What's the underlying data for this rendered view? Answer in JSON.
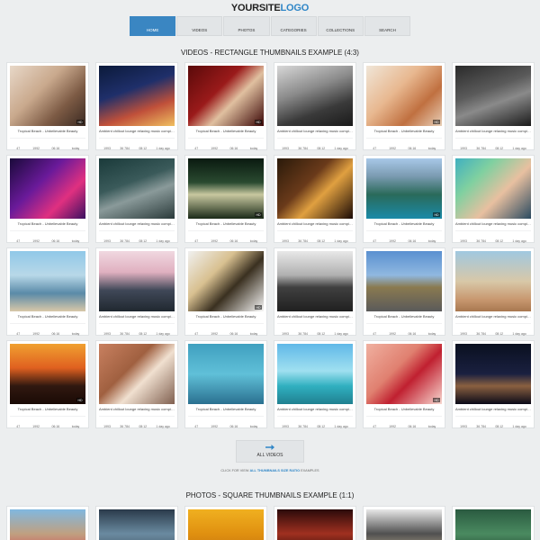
{
  "site": {
    "logo_part1": "YOURSITE",
    "logo_part2": "LOGO"
  },
  "nav": [
    {
      "label": "HOME",
      "icon": "home-icon",
      "active": true
    },
    {
      "label": "VIDEOS",
      "icon": "play-icon",
      "active": false
    },
    {
      "label": "PHOTOS",
      "icon": "photo-icon",
      "active": false
    },
    {
      "label": "CATEGORIES",
      "icon": "grid-icon",
      "active": false
    },
    {
      "label": "COLLECTIONS",
      "icon": "stack-icon",
      "active": false
    },
    {
      "label": "SEARCH",
      "icon": "search-icon",
      "active": false
    }
  ],
  "videos_section": {
    "title": "VIDEOS - RECTANGLE THUMBNAILS EXAMPLE (4:3)",
    "cards": [
      {
        "title": "Tropical Beach - Unbelievable Beauty",
        "badge": "HD",
        "stats": [
          "47",
          "1992",
          "06:16",
          "today"
        ],
        "bg": "linear-gradient(135deg,#e8d8c8 0%,#c9a98d 40%,#7c5a44 70%,#3a2a22 100%)"
      },
      {
        "title": "Ambient chillout lounge relaxing music compilation",
        "badge": "",
        "stats": [
          "1993",
          "36 784",
          "08:12",
          "1 day ago"
        ],
        "bg": "linear-gradient(160deg,#0b1a3a 0%,#1f2f6a 40%,#c0503a 70%,#f0c060 100%)"
      },
      {
        "title": "Tropical Beach - Unbelievable Beauty",
        "badge": "HD",
        "stats": [
          "47",
          "1992",
          "06:16",
          "today"
        ],
        "bg": "linear-gradient(135deg,#5a0a0a 0%,#9a1a1a 40%,#e0c0a0 60%,#3a0505 100%)"
      },
      {
        "title": "Ambient chillout lounge relaxing music compilation",
        "badge": "",
        "stats": [
          "1993",
          "36 784",
          "08:12",
          "1 day ago"
        ],
        "bg": "linear-gradient(160deg,#d8d8d8 0%,#8a8a8a 40%,#3a3a3a 70%,#1a1a1a 100%)"
      },
      {
        "title": "Tropical Beach - Unbelievable Beauty",
        "badge": "HD",
        "stats": [
          "47",
          "1992",
          "06:16",
          "today"
        ],
        "bg": "linear-gradient(135deg,#f0e6d8 0%,#e8b890 40%,#c07040 70%,#e8d0b8 100%)"
      },
      {
        "title": "Ambient chillout lounge relaxing music compilation",
        "badge": "",
        "stats": [
          "1993",
          "36 784",
          "08:12",
          "1 day ago"
        ],
        "bg": "linear-gradient(160deg,#2a2a2a 0%,#5a5a5a 40%,#8a8a8a 60%,#1a1a1a 100%)"
      },
      {
        "title": "Tropical Beach - Unbelievable Beauty",
        "badge": "",
        "stats": [
          "47",
          "1992",
          "06:16",
          "today"
        ],
        "bg": "linear-gradient(135deg,#1a0a3a 0%,#6a1a9a 40%,#e03080 70%,#3a1060 100%)"
      },
      {
        "title": "Ambient chillout lounge relaxing music compilation",
        "badge": "",
        "stats": [
          "1993",
          "36 784",
          "08:12",
          "1 day ago"
        ],
        "bg": "linear-gradient(160deg,#1a3a3a 0%,#3a5a5a 40%,#8a9a9a 60%,#2a3a3a 100%)"
      },
      {
        "title": "Tropical Beach - Unbelievable Beauty",
        "badge": "HD",
        "stats": [
          "47",
          "1992",
          "06:16",
          "today"
        ],
        "bg": "linear-gradient(180deg,#0a1a10 0%,#2a4a30 40%,#c8c8a0 60%,#1a2a18 100%)"
      },
      {
        "title": "Ambient chillout lounge relaxing music compilation",
        "badge": "",
        "stats": [
          "1993",
          "36 784",
          "08:12",
          "1 day ago"
        ],
        "bg": "linear-gradient(135deg,#2a1a0a 0%,#6a3a1a 40%,#e0a040 60%,#1a0a05 100%)"
      },
      {
        "title": "Tropical Beach - Unbelievable Beauty",
        "badge": "HD",
        "stats": [
          "47",
          "1992",
          "06:16",
          "today"
        ],
        "bg": "linear-gradient(180deg,#a8c8e8 0%,#7a9ab0 30%,#2a6a5a 60%,#1a8aa8 100%)"
      },
      {
        "title": "Ambient chillout lounge relaxing music compilation",
        "badge": "",
        "stats": [
          "1993",
          "36 784",
          "08:12",
          "1 day ago"
        ],
        "bg": "linear-gradient(135deg,#40b0c0 0%,#80d0a0 30%,#e8c0a0 60%,#2a4a60 100%)"
      },
      {
        "title": "Tropical Beach - Unbelievable Beauty",
        "badge": "",
        "stats": [
          "47",
          "1992",
          "06:16",
          "today"
        ],
        "bg": "linear-gradient(180deg,#90c8e8 0%,#b8d8e8 40%,#5a8aa8 70%,#d8c8a8 100%)"
      },
      {
        "title": "Ambient chillout lounge relaxing music compilation",
        "badge": "",
        "stats": [
          "1993",
          "36 784",
          "08:12",
          "1 day ago"
        ],
        "bg": "linear-gradient(180deg,#f0d8e0 0%,#e0b0c0 35%,#404858 65%,#202830 100%)"
      },
      {
        "title": "Tropical Beach - Unbelievable Beauty",
        "badge": "HD",
        "stats": [
          "47",
          "1992",
          "06:16",
          "today"
        ],
        "bg": "linear-gradient(135deg,#f0f0f0 0%,#d8c090 35%,#3a3020 60%,#f8f8f8 100%)"
      },
      {
        "title": "Ambient chillout lounge relaxing music compilation",
        "badge": "",
        "stats": [
          "1993",
          "36 784",
          "08:12",
          "1 day ago"
        ],
        "bg": "linear-gradient(180deg,#e8e8e8 0%,#b0b0b0 40%,#404040 60%,#202020 100%)"
      },
      {
        "title": "Tropical Beach - Unbelievable Beauty",
        "badge": "",
        "stats": [
          "47",
          "1992",
          "06:16",
          "today"
        ],
        "bg": "linear-gradient(180deg,#5a90d0 0%,#90b8e0 40%,#8a7a50 60%,#5a5a5a 100%)"
      },
      {
        "title": "Ambient chillout lounge relaxing music compilation",
        "badge": "",
        "stats": [
          "1993",
          "36 784",
          "08:12",
          "1 day ago"
        ],
        "bg": "linear-gradient(180deg,#a0c8e0 0%,#d8c8a8 50%,#c89870 80%,#a87850 100%)"
      },
      {
        "title": "Tropical Beach - Unbelievable Beauty",
        "badge": "HD",
        "stats": [
          "47",
          "1992",
          "06:16",
          "today"
        ],
        "bg": "linear-gradient(180deg,#f0a030 0%,#e06020 40%,#301810 70%,#1a0a05 100%)"
      },
      {
        "title": "Ambient chillout lounge relaxing music compilation",
        "badge": "",
        "stats": [
          "1993",
          "36 784",
          "08:12",
          "1 day ago"
        ],
        "bg": "linear-gradient(135deg,#c88060 0%,#a06040 40%,#f0e0d0 60%,#806050 100%)"
      },
      {
        "title": "Tropical Beach - Unbelievable Beauty",
        "badge": "",
        "stats": [
          "47",
          "1992",
          "06:16",
          "today"
        ],
        "bg": "linear-gradient(180deg,#40a0c0 0%,#60c0d8 50%,#2a7090 100%)"
      },
      {
        "title": "Ambient chillout lounge relaxing music compilation",
        "badge": "",
        "stats": [
          "1993",
          "36 784",
          "08:12",
          "1 day ago"
        ],
        "bg": "linear-gradient(180deg,#60b8e8 0%,#a0e0f0 45%,#30b0c0 70%,#208090 100%)"
      },
      {
        "title": "Tropical Beach - Unbelievable Beauty",
        "badge": "HD",
        "stats": [
          "47",
          "1992",
          "06:16",
          "today"
        ],
        "bg": "linear-gradient(135deg,#f0b0a0 0%,#e08070 40%,#c02030 60%,#f8d8d0 100%)"
      },
      {
        "title": "Ambient chillout lounge relaxing music compilation",
        "badge": "",
        "stats": [
          "1993",
          "36 784",
          "08:12",
          "1 day ago"
        ],
        "bg": "linear-gradient(180deg,#0a1020 0%,#1a2040 50%,#8a6040 70%,#0a0a18 100%)"
      }
    ]
  },
  "all_videos_button": {
    "label": "ALL VIDEOS"
  },
  "note": {
    "prefix": "CLICK FOR VIEW ",
    "link": "ALL THUMBNAILS SIZE RATIO",
    "suffix": " EXAMPLES"
  },
  "photos_section": {
    "title": "PHOTOS - SQUARE THUMBNAILS EXAMPLE (1:1)",
    "cards": [
      {
        "bg": "linear-gradient(180deg,#80b8e0 0%,#c0a080 50%,#d04050 100%)"
      },
      {
        "bg": "linear-gradient(180deg,#2a3a4a 0%,#6a8aa0 50%,#3a4a5a 100%)"
      },
      {
        "bg": "linear-gradient(180deg,#f0b020 0%,#e09010 50%,#c07010 100%)"
      },
      {
        "bg": "linear-gradient(180deg,#2a0a0a 0%,#a03020 50%,#1a0505 100%)"
      },
      {
        "bg": "linear-gradient(180deg,#e8e8e8 0%,#505050 50%,#d0c0a0 100%)"
      },
      {
        "bg": "linear-gradient(180deg,#2a5a40 0%,#4a8a60 50%,#1a3a28 100%)"
      }
    ]
  },
  "icons": {
    "stat_icons": [
      "thumbs-up-icon",
      "eye-icon",
      "clock-icon",
      "cloud-icon"
    ]
  },
  "colors": {
    "accent": "#3a86c2",
    "background": "#eceeef"
  }
}
